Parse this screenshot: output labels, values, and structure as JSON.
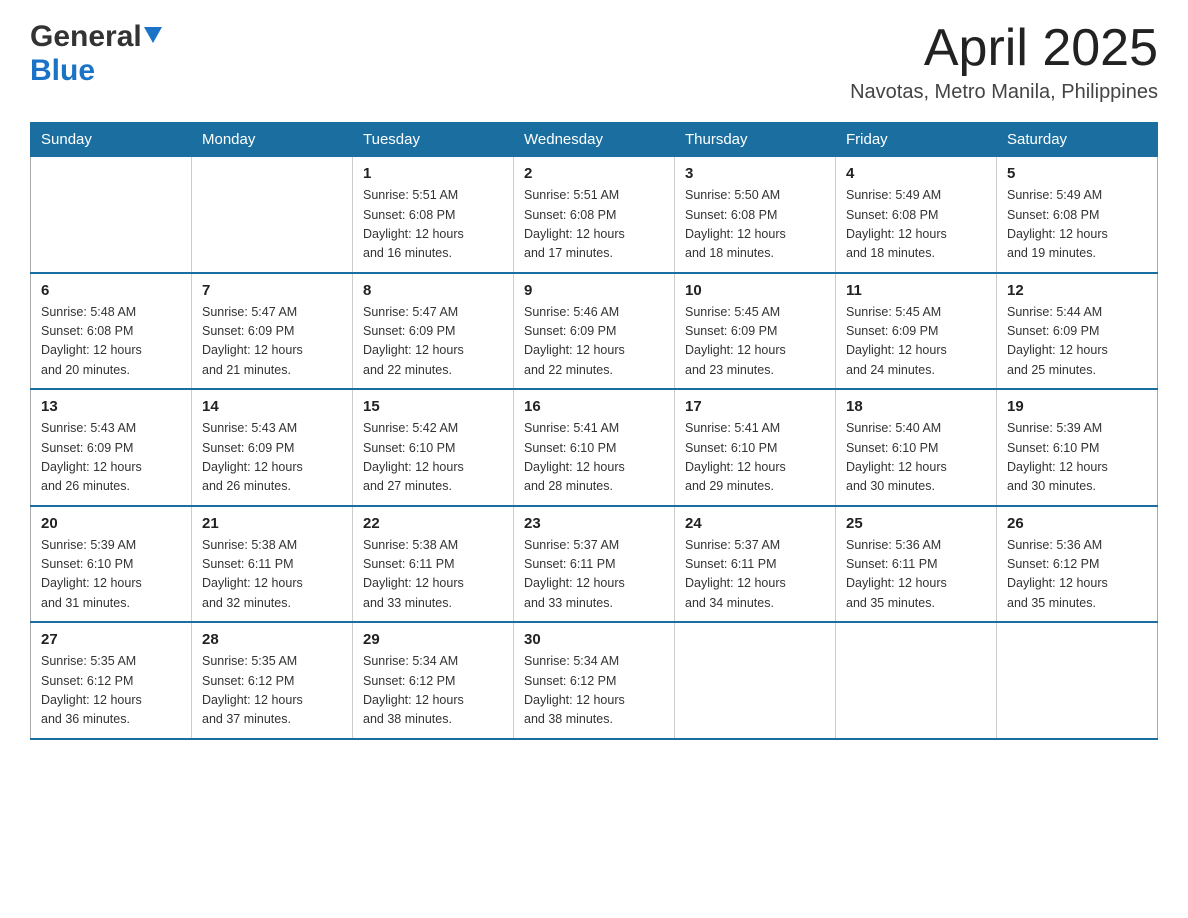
{
  "header": {
    "logo": {
      "general": "General",
      "blue": "Blue"
    },
    "title": "April 2025",
    "subtitle": "Navotas, Metro Manila, Philippines"
  },
  "calendar": {
    "days_of_week": [
      "Sunday",
      "Monday",
      "Tuesday",
      "Wednesday",
      "Thursday",
      "Friday",
      "Saturday"
    ],
    "weeks": [
      [
        {
          "day": "",
          "info": ""
        },
        {
          "day": "",
          "info": ""
        },
        {
          "day": "1",
          "info": "Sunrise: 5:51 AM\nSunset: 6:08 PM\nDaylight: 12 hours\nand 16 minutes."
        },
        {
          "day": "2",
          "info": "Sunrise: 5:51 AM\nSunset: 6:08 PM\nDaylight: 12 hours\nand 17 minutes."
        },
        {
          "day": "3",
          "info": "Sunrise: 5:50 AM\nSunset: 6:08 PM\nDaylight: 12 hours\nand 18 minutes."
        },
        {
          "day": "4",
          "info": "Sunrise: 5:49 AM\nSunset: 6:08 PM\nDaylight: 12 hours\nand 18 minutes."
        },
        {
          "day": "5",
          "info": "Sunrise: 5:49 AM\nSunset: 6:08 PM\nDaylight: 12 hours\nand 19 minutes."
        }
      ],
      [
        {
          "day": "6",
          "info": "Sunrise: 5:48 AM\nSunset: 6:08 PM\nDaylight: 12 hours\nand 20 minutes."
        },
        {
          "day": "7",
          "info": "Sunrise: 5:47 AM\nSunset: 6:09 PM\nDaylight: 12 hours\nand 21 minutes."
        },
        {
          "day": "8",
          "info": "Sunrise: 5:47 AM\nSunset: 6:09 PM\nDaylight: 12 hours\nand 22 minutes."
        },
        {
          "day": "9",
          "info": "Sunrise: 5:46 AM\nSunset: 6:09 PM\nDaylight: 12 hours\nand 22 minutes."
        },
        {
          "day": "10",
          "info": "Sunrise: 5:45 AM\nSunset: 6:09 PM\nDaylight: 12 hours\nand 23 minutes."
        },
        {
          "day": "11",
          "info": "Sunrise: 5:45 AM\nSunset: 6:09 PM\nDaylight: 12 hours\nand 24 minutes."
        },
        {
          "day": "12",
          "info": "Sunrise: 5:44 AM\nSunset: 6:09 PM\nDaylight: 12 hours\nand 25 minutes."
        }
      ],
      [
        {
          "day": "13",
          "info": "Sunrise: 5:43 AM\nSunset: 6:09 PM\nDaylight: 12 hours\nand 26 minutes."
        },
        {
          "day": "14",
          "info": "Sunrise: 5:43 AM\nSunset: 6:09 PM\nDaylight: 12 hours\nand 26 minutes."
        },
        {
          "day": "15",
          "info": "Sunrise: 5:42 AM\nSunset: 6:10 PM\nDaylight: 12 hours\nand 27 minutes."
        },
        {
          "day": "16",
          "info": "Sunrise: 5:41 AM\nSunset: 6:10 PM\nDaylight: 12 hours\nand 28 minutes."
        },
        {
          "day": "17",
          "info": "Sunrise: 5:41 AM\nSunset: 6:10 PM\nDaylight: 12 hours\nand 29 minutes."
        },
        {
          "day": "18",
          "info": "Sunrise: 5:40 AM\nSunset: 6:10 PM\nDaylight: 12 hours\nand 30 minutes."
        },
        {
          "day": "19",
          "info": "Sunrise: 5:39 AM\nSunset: 6:10 PM\nDaylight: 12 hours\nand 30 minutes."
        }
      ],
      [
        {
          "day": "20",
          "info": "Sunrise: 5:39 AM\nSunset: 6:10 PM\nDaylight: 12 hours\nand 31 minutes."
        },
        {
          "day": "21",
          "info": "Sunrise: 5:38 AM\nSunset: 6:11 PM\nDaylight: 12 hours\nand 32 minutes."
        },
        {
          "day": "22",
          "info": "Sunrise: 5:38 AM\nSunset: 6:11 PM\nDaylight: 12 hours\nand 33 minutes."
        },
        {
          "day": "23",
          "info": "Sunrise: 5:37 AM\nSunset: 6:11 PM\nDaylight: 12 hours\nand 33 minutes."
        },
        {
          "day": "24",
          "info": "Sunrise: 5:37 AM\nSunset: 6:11 PM\nDaylight: 12 hours\nand 34 minutes."
        },
        {
          "day": "25",
          "info": "Sunrise: 5:36 AM\nSunset: 6:11 PM\nDaylight: 12 hours\nand 35 minutes."
        },
        {
          "day": "26",
          "info": "Sunrise: 5:36 AM\nSunset: 6:12 PM\nDaylight: 12 hours\nand 35 minutes."
        }
      ],
      [
        {
          "day": "27",
          "info": "Sunrise: 5:35 AM\nSunset: 6:12 PM\nDaylight: 12 hours\nand 36 minutes."
        },
        {
          "day": "28",
          "info": "Sunrise: 5:35 AM\nSunset: 6:12 PM\nDaylight: 12 hours\nand 37 minutes."
        },
        {
          "day": "29",
          "info": "Sunrise: 5:34 AM\nSunset: 6:12 PM\nDaylight: 12 hours\nand 38 minutes."
        },
        {
          "day": "30",
          "info": "Sunrise: 5:34 AM\nSunset: 6:12 PM\nDaylight: 12 hours\nand 38 minutes."
        },
        {
          "day": "",
          "info": ""
        },
        {
          "day": "",
          "info": ""
        },
        {
          "day": "",
          "info": ""
        }
      ]
    ]
  }
}
